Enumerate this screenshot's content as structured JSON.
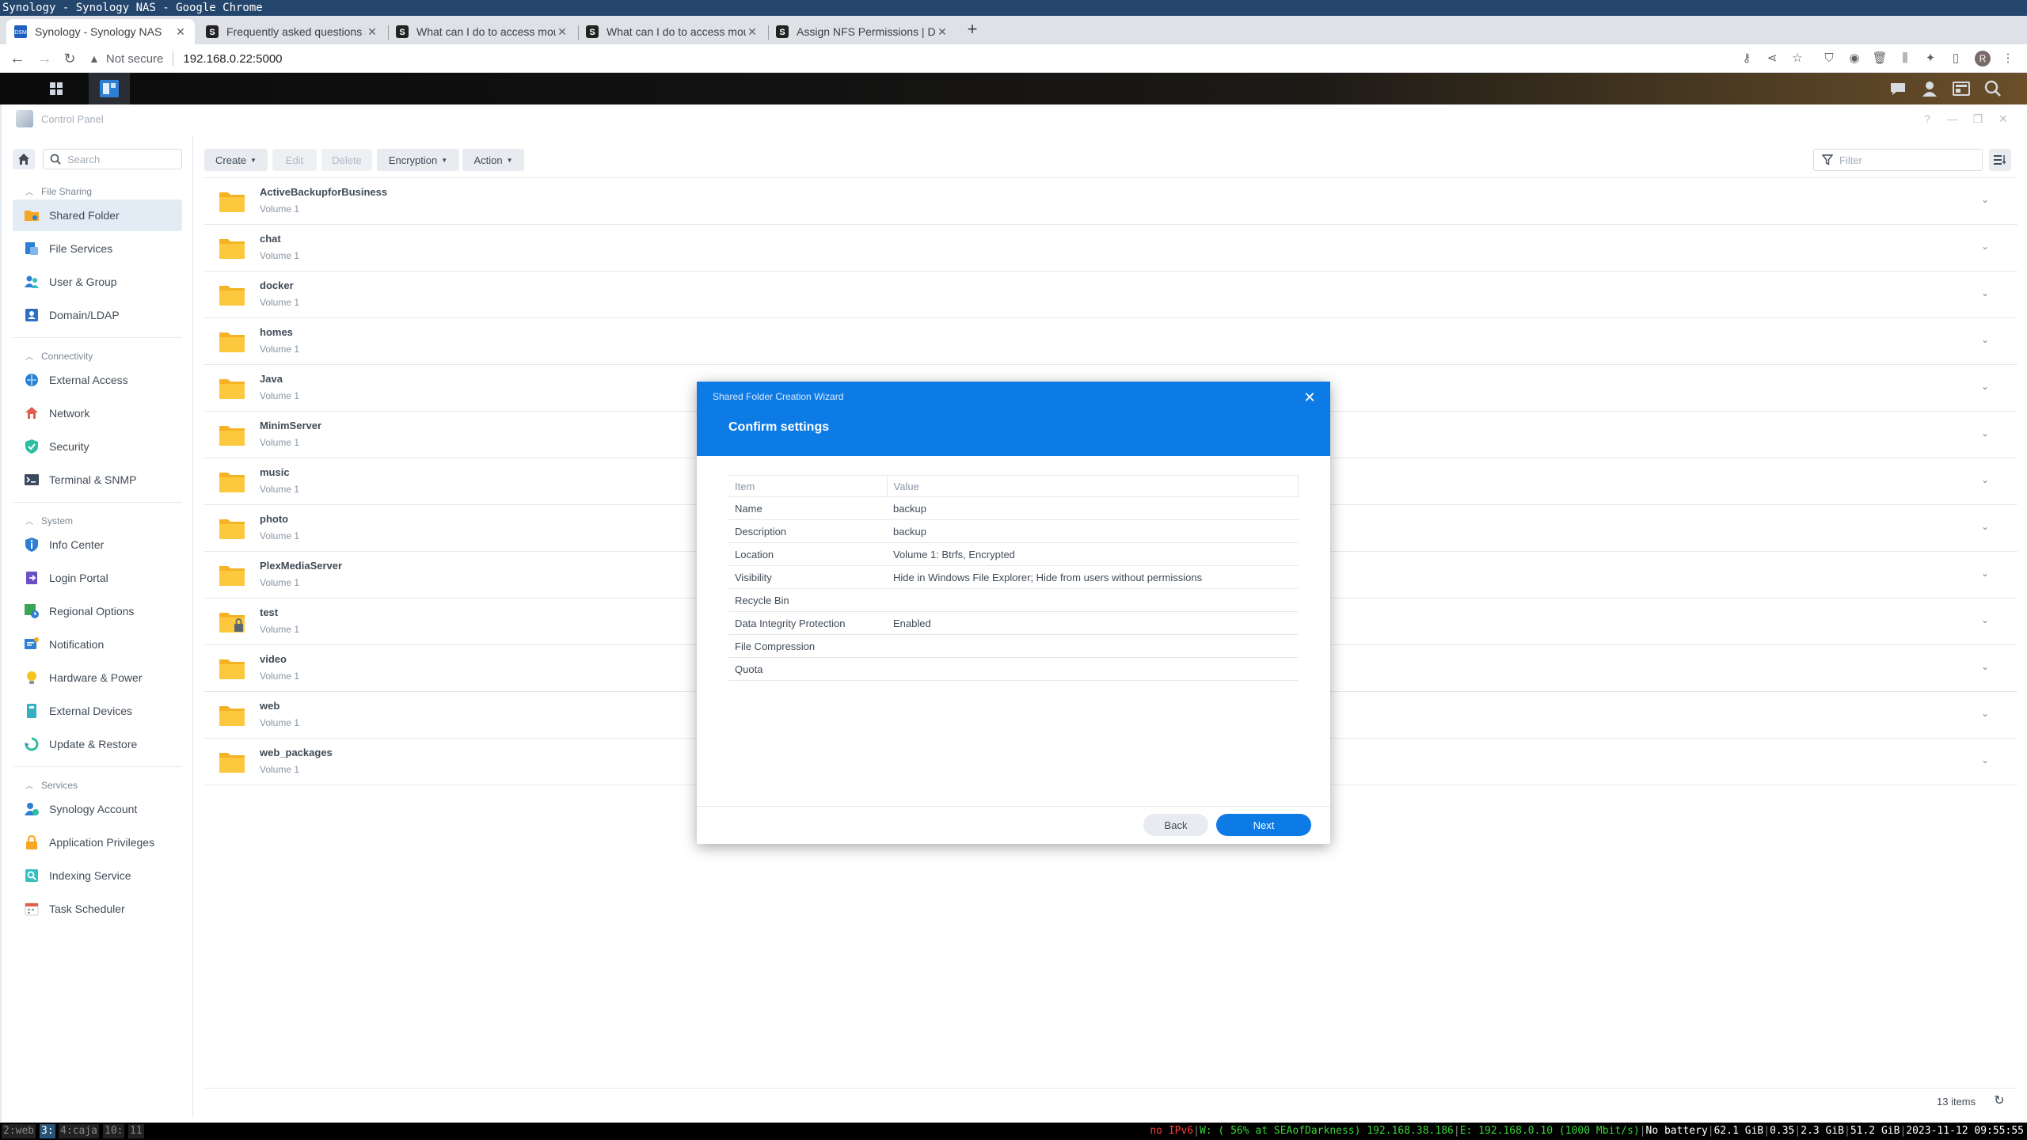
{
  "window_title": "Synology - Synology NAS - Google Chrome",
  "browser": {
    "tabs": [
      {
        "label": "Synology - Synology NAS",
        "favicon": "dsm-icon",
        "active": true
      },
      {
        "label": "Frequently asked questions a",
        "favicon": "synology-s-icon",
        "active": false
      },
      {
        "label": "What can I do to access mou",
        "favicon": "synology-s-icon",
        "active": false
      },
      {
        "label": "What can I do to access mou",
        "favicon": "synology-s-icon",
        "active": false
      },
      {
        "label": "Assign NFS Permissions | D",
        "favicon": "synology-s-icon",
        "active": false
      }
    ],
    "not_secure": "Not secure",
    "url": "192.168.0.22:5000",
    "profile_initial": "R"
  },
  "control_panel": {
    "title": "Control Panel",
    "search_placeholder": "Search",
    "sections": [
      {
        "label": "File Sharing",
        "items": [
          {
            "label": "Shared Folder",
            "icon": "shared-folder-icon",
            "active": true
          },
          {
            "label": "File Services",
            "icon": "file-services-icon"
          },
          {
            "label": "User & Group",
            "icon": "user-group-icon"
          },
          {
            "label": "Domain/LDAP",
            "icon": "domain-ldap-icon"
          }
        ]
      },
      {
        "label": "Connectivity",
        "items": [
          {
            "label": "External Access",
            "icon": "external-access-icon"
          },
          {
            "label": "Network",
            "icon": "network-icon"
          },
          {
            "label": "Security",
            "icon": "security-icon"
          },
          {
            "label": "Terminal & SNMP",
            "icon": "terminal-icon"
          }
        ]
      },
      {
        "label": "System",
        "items": [
          {
            "label": "Info Center",
            "icon": "info-icon"
          },
          {
            "label": "Login Portal",
            "icon": "login-portal-icon"
          },
          {
            "label": "Regional Options",
            "icon": "regional-options-icon"
          },
          {
            "label": "Notification",
            "icon": "notification-icon"
          },
          {
            "label": "Hardware & Power",
            "icon": "hardware-power-icon"
          },
          {
            "label": "External Devices",
            "icon": "external-devices-icon"
          },
          {
            "label": "Update & Restore",
            "icon": "update-restore-icon"
          }
        ]
      },
      {
        "label": "Services",
        "items": [
          {
            "label": "Synology Account",
            "icon": "synology-account-icon"
          },
          {
            "label": "Application Privileges",
            "icon": "app-privileges-icon"
          },
          {
            "label": "Indexing Service",
            "icon": "indexing-icon"
          },
          {
            "label": "Task Scheduler",
            "icon": "task-scheduler-icon"
          }
        ]
      }
    ],
    "toolbar": {
      "create": "Create",
      "edit": "Edit",
      "delete": "Delete",
      "encryption": "Encryption",
      "action": "Action",
      "filter_placeholder": "Filter"
    },
    "folders": [
      {
        "name": "ActiveBackupforBusiness",
        "volume": "Volume 1"
      },
      {
        "name": "chat",
        "volume": "Volume 1"
      },
      {
        "name": "docker",
        "volume": "Volume 1"
      },
      {
        "name": "homes",
        "volume": "Volume 1"
      },
      {
        "name": "Java",
        "volume": "Volume 1"
      },
      {
        "name": "MinimServer",
        "volume": "Volume 1"
      },
      {
        "name": "music",
        "volume": "Volume 1"
      },
      {
        "name": "photo",
        "volume": "Volume 1"
      },
      {
        "name": "PlexMediaServer",
        "volume": "Volume 1"
      },
      {
        "name": "test",
        "volume": "Volume 1",
        "locked": true
      },
      {
        "name": "video",
        "volume": "Volume 1"
      },
      {
        "name": "web",
        "volume": "Volume 1"
      },
      {
        "name": "web_packages",
        "volume": "Volume 1"
      }
    ],
    "item_count": "13 items"
  },
  "dialog": {
    "wizard_title": "Shared Folder Creation Wizard",
    "title": "Confirm settings",
    "columns": [
      "Item",
      "Value"
    ],
    "rows": [
      {
        "item": "Name",
        "value": "backup"
      },
      {
        "item": "Description",
        "value": "backup"
      },
      {
        "item": "Location",
        "value": "Volume 1: Btrfs, Encrypted"
      },
      {
        "item": "Visibility",
        "value": "Hide in Windows File Explorer; Hide from users without permissions"
      },
      {
        "item": "Recycle Bin",
        "value": ""
      },
      {
        "item": "Data Integrity Protection",
        "value": "Enabled"
      },
      {
        "item": "File Compression",
        "value": ""
      },
      {
        "item": "Quota",
        "value": ""
      }
    ],
    "back": "Back",
    "next": "Next"
  },
  "statusbar": {
    "workspaces": [
      {
        "label": "2:web",
        "current": false
      },
      {
        "label": "3:",
        "current": true
      },
      {
        "label": "4:caja",
        "current": false
      },
      {
        "label": "10:",
        "current": false
      },
      {
        "label": "11",
        "current": false
      }
    ],
    "segments": [
      {
        "text": "no IPv6",
        "color": "#ff3b3b"
      },
      {
        "text": "W: ( 56% at SEAofDarkness) 192.168.38.186",
        "color": "#38d438"
      },
      {
        "text": "E: 192.168.0.10 (1000 Mbit/s)",
        "color": "#38d438"
      },
      {
        "text": "No battery",
        "color": "#ffffff"
      },
      {
        "text": "62.1 GiB",
        "color": "#ffffff"
      },
      {
        "text": "0.35",
        "color": "#ffffff"
      },
      {
        "text": "2.3 GiB",
        "color": "#ffffff"
      },
      {
        "text": "51.2 GiB",
        "color": "#ffffff"
      },
      {
        "text": "2023-11-12 09:55:55",
        "color": "#ffffff"
      }
    ]
  }
}
